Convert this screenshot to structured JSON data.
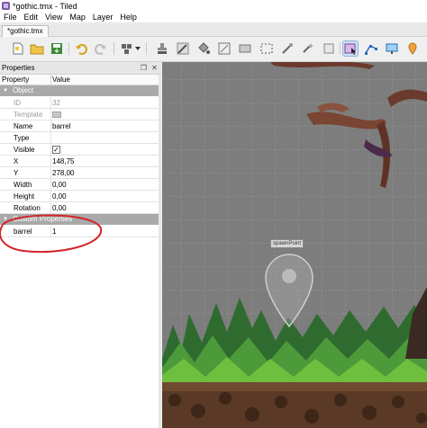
{
  "window": {
    "title": "*gothic.tmx - Tiled"
  },
  "menu": [
    "File",
    "Edit",
    "View",
    "Map",
    "Layer",
    "Help"
  ],
  "tabs": [
    {
      "label": "*gothic.tmx"
    }
  ],
  "toolbar": {
    "icons": [
      "new-file-icon",
      "open-file-icon",
      "save-icon",
      "undo-icon",
      "redo-icon",
      "command-dropdown-icon",
      "stamp-brush-icon",
      "terrain-brush-icon",
      "bucket-fill-icon",
      "shape-fill-icon",
      "eraser-icon",
      "rect-select-icon",
      "magic-wand-icon",
      "select-same-tile-icon",
      "select-objects-icon",
      "edit-polygons-icon",
      "insert-rectangle-icon",
      "insert-point-icon"
    ],
    "active": "select-objects-icon"
  },
  "properties": {
    "title": "Properties",
    "col_property": "Property",
    "col_value": "Value",
    "group_object": "Object",
    "rows": [
      {
        "name": "ID",
        "value": "32",
        "disabled": true
      },
      {
        "name": "Template",
        "value": "",
        "disabled": true
      },
      {
        "name": "Name",
        "value": "barrel"
      },
      {
        "name": "Type",
        "value": ""
      },
      {
        "name": "Visible",
        "value": "✓"
      },
      {
        "name": "X",
        "value": "148,75"
      },
      {
        "name": "Y",
        "value": "278,00"
      },
      {
        "name": "Width",
        "value": "0,00"
      },
      {
        "name": "Height",
        "value": "0,00"
      },
      {
        "name": "Rotation",
        "value": "0,00"
      }
    ],
    "group_custom": "Custom Properties",
    "custom_rows": [
      {
        "name": "barrel",
        "value": "1"
      }
    ]
  },
  "map": {
    "object_label": "spawnPoint"
  },
  "colors": {
    "annotation": "#d0262b",
    "selected_tool": "#cde0f5",
    "group_header": "#a9a9a9"
  }
}
